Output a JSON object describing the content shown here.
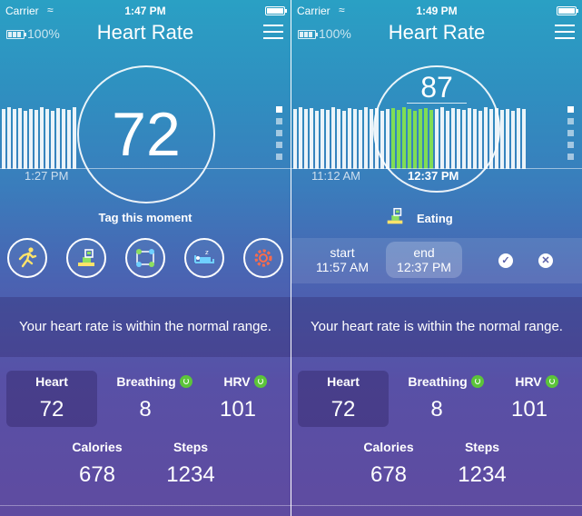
{
  "left": {
    "status": {
      "carrier": "Carrier",
      "time": "1:47 PM"
    },
    "battery_percent": "100%",
    "title": "Heart Rate",
    "bpm": "72",
    "time_label": "1:27 PM",
    "tag_label": "Tag this moment",
    "icons": [
      "running-icon",
      "eating-icon",
      "meeting-icon",
      "sleeping-icon",
      "gear-icon"
    ],
    "message": "Your heart rate is within the normal range.",
    "stats": {
      "heart_label": "Heart",
      "heart_value": "72",
      "breathing_label": "Breathing",
      "breathing_value": "8",
      "hrv_label": "HRV",
      "hrv_value": "101",
      "calories_label": "Calories",
      "calories_value": "678",
      "steps_label": "Steps",
      "steps_value": "1234"
    }
  },
  "right": {
    "status": {
      "carrier": "Carrier",
      "time": "1:49 PM"
    },
    "battery_percent": "100%",
    "title": "Heart Rate",
    "bpm": "87",
    "time_label_left": "11:12 AM",
    "time_label_center": "12:37 PM",
    "tag_label": "Eating",
    "edit": {
      "start_label": "start",
      "start_time": "11:57 AM",
      "end_label": "end",
      "end_time": "12:37 PM"
    },
    "message": "Your heart rate is within the normal range.",
    "stats": {
      "heart_label": "Heart",
      "heart_value": "72",
      "breathing_label": "Breathing",
      "breathing_value": "8",
      "hrv_label": "HRV",
      "hrv_value": "101",
      "calories_label": "Calories",
      "calories_value": "678",
      "steps_label": "Steps",
      "steps_value": "1234"
    }
  },
  "colors": {
    "accent_green": "#7fdd55",
    "status_green": "#5cc43a",
    "bg_top": "#2aa0c4",
    "bg_bottom": "#5f4ba0"
  }
}
